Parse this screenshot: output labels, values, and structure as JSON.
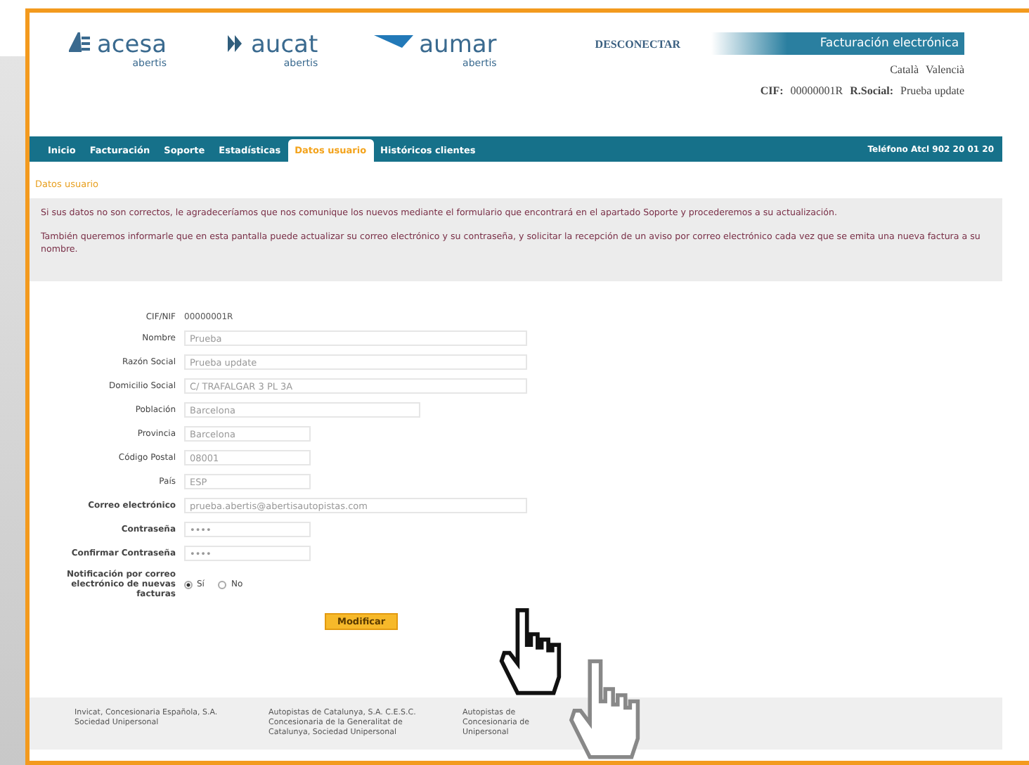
{
  "header": {
    "logos": [
      {
        "name": "acesa",
        "sub": "abertis"
      },
      {
        "name": "aucat",
        "sub": "abertis"
      },
      {
        "name": "aumar",
        "sub": "abertis"
      }
    ],
    "disconnect": "DESCONECTAR",
    "banner": "Facturación electrónica",
    "languages": [
      "Català",
      "Valencià"
    ],
    "cif_label": "CIF:",
    "cif": "00000001R",
    "social_label": "R.Social:",
    "social": "Prueba update"
  },
  "nav": {
    "items": [
      {
        "label": "Inicio",
        "selected": false
      },
      {
        "label": "Facturación",
        "selected": false
      },
      {
        "label": "Soporte",
        "selected": false
      },
      {
        "label": "Estadísticas",
        "selected": false
      },
      {
        "label": "Datos usuario",
        "selected": true
      },
      {
        "label": "Históricos clientes",
        "selected": false
      }
    ],
    "phone": "Teléfono Atcl 902 20 01 20"
  },
  "breadcrumb": "Datos usuario",
  "notice": [
    "Si sus datos no son correctos, le agradeceríamos que nos comunique los nuevos mediante el formulario que encontrará en el apartado Soporte y procederemos a su actualización.",
    "También queremos informarle que en esta pantalla puede actualizar su correo electrónico y su contraseña, y solicitar la recepción de un aviso por correo electrónico cada vez que se emita una nueva factura a su nombre."
  ],
  "form": {
    "rows": [
      {
        "kind": "static",
        "label": "CIF/NIF",
        "value": "00000001R",
        "bold": false
      },
      {
        "kind": "text",
        "label": "Nombre",
        "value": "Prueba",
        "bold": false
      },
      {
        "kind": "text",
        "label": "Razón Social",
        "value": "Prueba update",
        "bold": false
      },
      {
        "kind": "text",
        "label": "Domicilio Social",
        "value": "C/ TRAFALGAR 3 PL 3A",
        "bold": false
      },
      {
        "kind": "text",
        "label": "Población",
        "value": "Barcelona",
        "bold": false
      },
      {
        "kind": "text",
        "label": "Provincia",
        "value": "Barcelona",
        "bold": false
      },
      {
        "kind": "text",
        "label": "Código Postal",
        "value": "08001",
        "bold": false
      },
      {
        "kind": "text",
        "label": "País",
        "value": "ESP",
        "bold": false
      },
      {
        "kind": "text",
        "label": "Correo electrónico",
        "value": "prueba.abertis@abertisautopistas.com",
        "bold": true
      },
      {
        "kind": "text",
        "label": "Contraseña",
        "value": "••••",
        "bold": true
      },
      {
        "kind": "text",
        "label": "Confirmar Contraseña",
        "value": "••••",
        "bold": true
      },
      {
        "kind": "radio",
        "label": "Notificación por correo electrónico de nuevas facturas",
        "bold": true,
        "options": [
          {
            "label": "Sí",
            "selected": true
          },
          {
            "label": "No",
            "selected": false
          }
        ]
      }
    ],
    "submit": "Modificar"
  },
  "footer": [
    "Invicat, Concesionaria Española, S.A. Sociedad Unipersonal",
    "Autopistas de Catalunya, S.A. C.E.S.C. Concesionaria de la Generalitat de Catalunya, Sociedad Unipersonal",
    "Autopistas de Concesionaria de Unipersonal"
  ]
}
